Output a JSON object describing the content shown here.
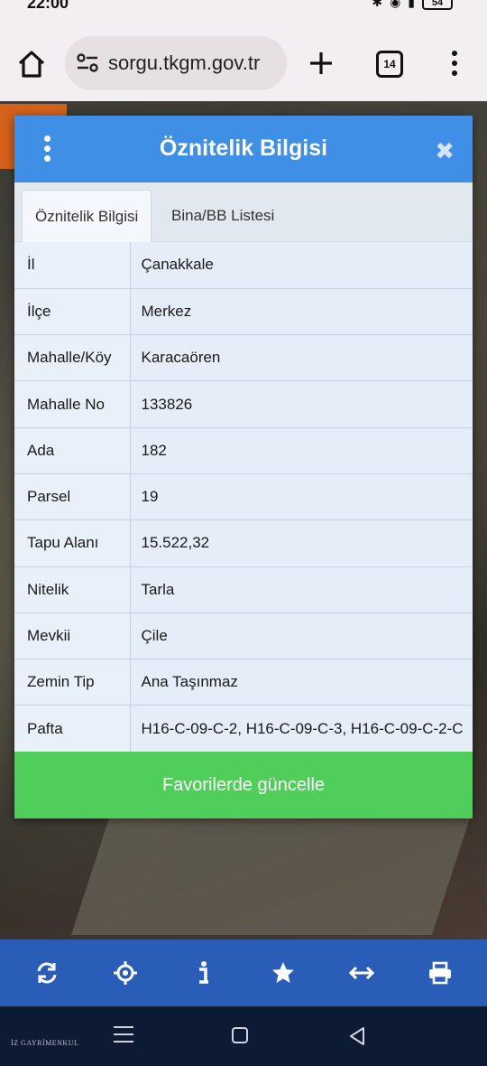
{
  "status_bar": {
    "time": "22:00",
    "battery": "54"
  },
  "browser": {
    "url": "sorgu.tkgm.gov.tr",
    "tab_count": "14"
  },
  "popup": {
    "title": "Öznitelik Bilgisi",
    "close": "✖",
    "tabs": [
      {
        "label": "Öznitelik Bilgisi",
        "active": true
      },
      {
        "label": "Bina/BB Listesi",
        "active": false
      }
    ],
    "rows": [
      {
        "key": "İl",
        "value": "Çanakkale"
      },
      {
        "key": "İlçe",
        "value": "Merkez"
      },
      {
        "key": "Mahalle/Köy",
        "value": "Karacaören"
      },
      {
        "key": "Mahalle No",
        "value": "133826"
      },
      {
        "key": "Ada",
        "value": "182"
      },
      {
        "key": "Parsel",
        "value": "19"
      },
      {
        "key": "Tapu Alanı",
        "value": "15.522,32"
      },
      {
        "key": "Nitelik",
        "value": "Tarla"
      },
      {
        "key": "Mevkii",
        "value": "Çile"
      },
      {
        "key": "Zemin Tip",
        "value": "Ana Taşınmaz"
      },
      {
        "key": "Pafta",
        "value": "H16-C-09-C-2, H16-C-09-C-3, H16-C-09-C-2-C"
      }
    ],
    "favorite_button": "Favorilerde güncelle"
  },
  "map_toolbar": {
    "icons": [
      "refresh-icon",
      "locate-icon",
      "info-icon",
      "star-icon",
      "measure-icon",
      "print-icon"
    ]
  },
  "watermark": "İZ GAYRİMENKUL",
  "colors": {
    "header_blue": "#3f8fe6",
    "button_green": "#4fcf5a",
    "toolbar_blue": "#2a5db8"
  }
}
